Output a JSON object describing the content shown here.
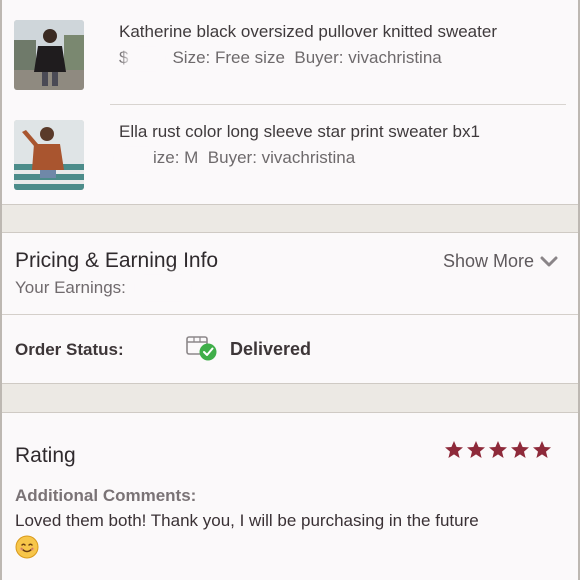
{
  "items": [
    {
      "title": "Katherine black oversized pullover knitted sweater",
      "price": "$",
      "size": "Size: Free size",
      "buyer": "Buyer: vivachristina",
      "thumb_icon": "sweater-photo-black"
    },
    {
      "title": "Ella rust color long sleeve star print sweater bx1",
      "price": "",
      "size": "ize: M",
      "buyer": "Buyer: vivachristina",
      "thumb_icon": "sweater-photo-rust"
    }
  ],
  "pricing": {
    "title": "Pricing & Earning Info",
    "earnings_label": "Your Earnings:",
    "show_more": "Show More"
  },
  "order": {
    "label": "Order Status:",
    "status": "Delivered",
    "status_color": "#3fae49"
  },
  "rating": {
    "label": "Rating",
    "stars": 5,
    "star_color": "#8e2a3a",
    "comments_label": "Additional Comments:",
    "comments_text": "Loved them both! Thank you, I will be purchasing in the future",
    "emoji": "smiling-face-emoji"
  }
}
